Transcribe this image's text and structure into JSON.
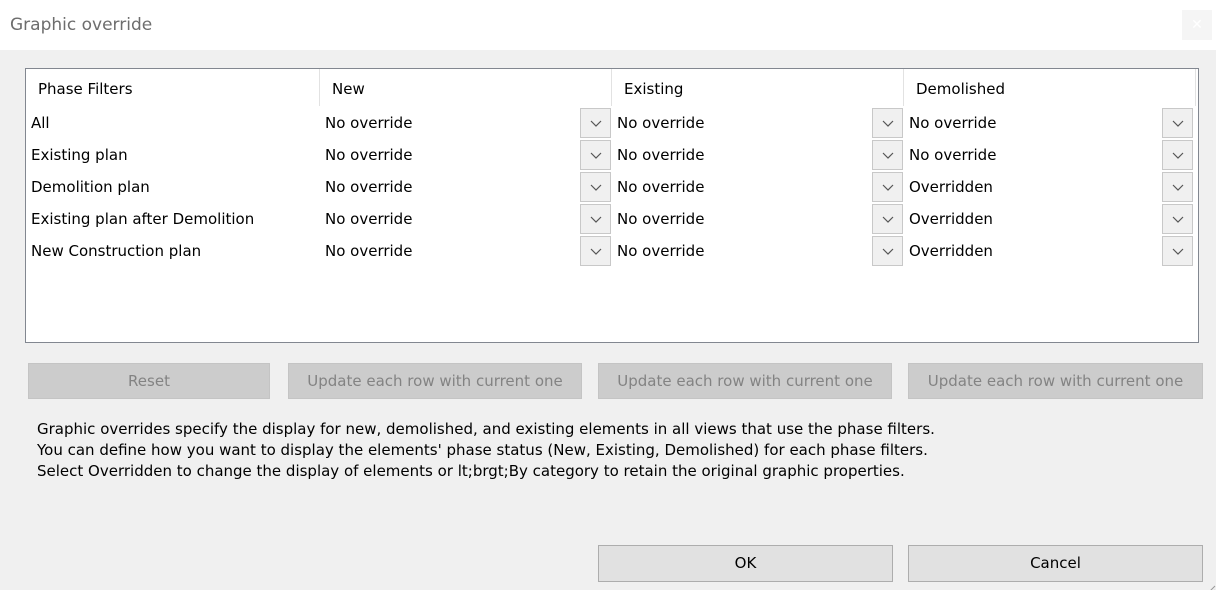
{
  "window": {
    "title": "Graphic override",
    "close_glyph": "✕"
  },
  "grid": {
    "headers": [
      "Phase Filters",
      "New",
      "Existing",
      "Demolished"
    ],
    "rows": [
      {
        "name": "All",
        "new": "No override",
        "existing": "No override",
        "demolished": "No override"
      },
      {
        "name": "Existing plan",
        "new": "No override",
        "existing": "No override",
        "demolished": "No override"
      },
      {
        "name": "Demolition plan",
        "new": "No override",
        "existing": "No override",
        "demolished": "Overridden"
      },
      {
        "name": "Existing plan after Demolition",
        "new": "No override",
        "existing": "No override",
        "demolished": "Overridden"
      },
      {
        "name": "New Construction plan",
        "new": "No override",
        "existing": "No override",
        "demolished": "Overridden"
      }
    ]
  },
  "buttons": {
    "reset": "Reset",
    "update_new": "Update each row with current one",
    "update_existing": "Update each row with current one",
    "update_demolished": "Update each row with current one",
    "ok": "OK",
    "cancel": "Cancel"
  },
  "description": {
    "line1": "Graphic overrides specify the display for new, demolished, and existing elements in all views that use the phase filters.",
    "line2": "You can define how you want to display the elements' phase status (New, Existing, Demolished) for each phase filters.",
    "line3": "Select Overridden to change the display of elements or lt;brgt;By category to retain the original graphic properties."
  },
  "icons": {
    "close": "close-icon",
    "dropdown": "chevron-down-icon",
    "resize": "resize-grip-icon"
  }
}
